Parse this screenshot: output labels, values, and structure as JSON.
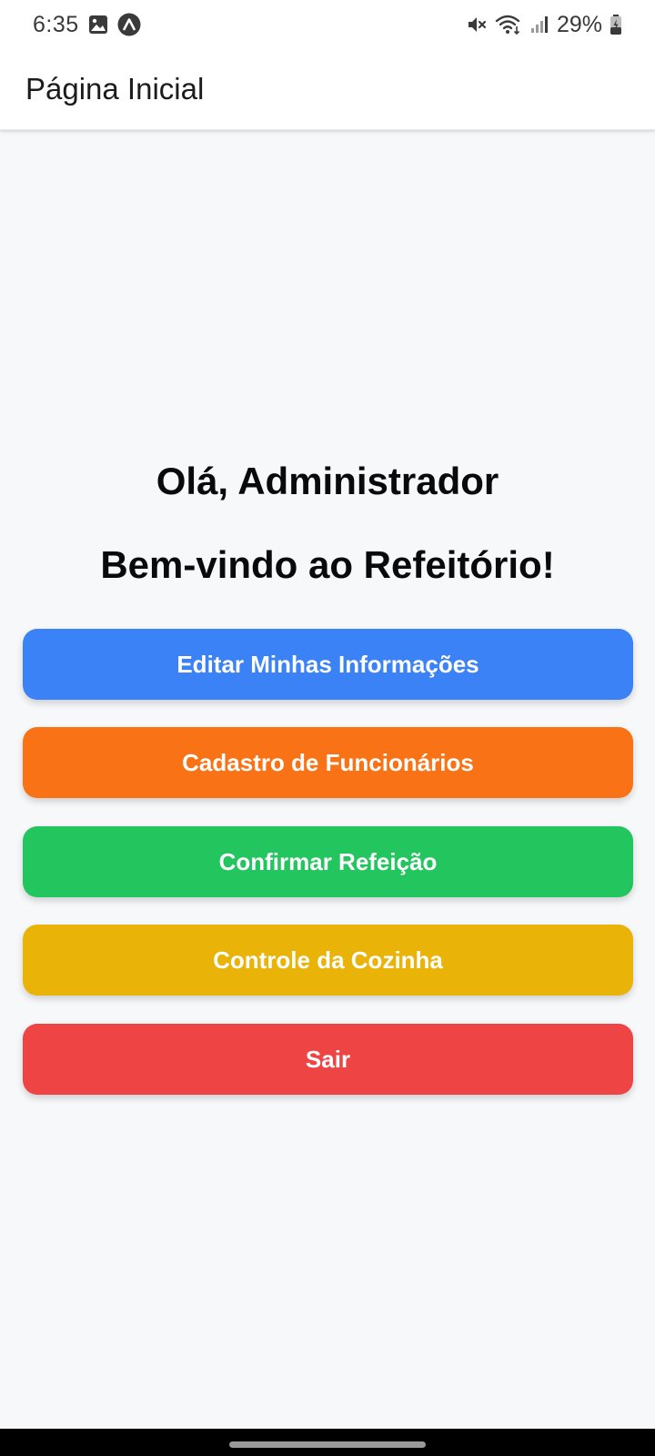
{
  "status_bar": {
    "time": "6:35",
    "battery_percent": "29%",
    "left_icons": [
      "image-icon",
      "app-a-icon"
    ],
    "right_icons": [
      "mute-icon",
      "wifi-icon",
      "signal-icon",
      "battery-charging-icon"
    ]
  },
  "app_bar": {
    "title": "Página Inicial"
  },
  "main": {
    "greeting": "Olá, Administrador",
    "welcome": "Bem-vindo ao Refeitório!",
    "buttons": [
      {
        "label": "Editar Minhas Informações",
        "color": "#3b82f6"
      },
      {
        "label": "Cadastro de Funcionários",
        "color": "#f97316"
      },
      {
        "label": "Confirmar Refeição",
        "color": "#22c55e"
      },
      {
        "label": "Controle da Cozinha",
        "color": "#eab308"
      },
      {
        "label": "Sair",
        "color": "#ef4444"
      }
    ]
  },
  "colors": {
    "background": "#f7f8fa",
    "app_bar": "#ffffff",
    "text": "#0a0a0a"
  }
}
